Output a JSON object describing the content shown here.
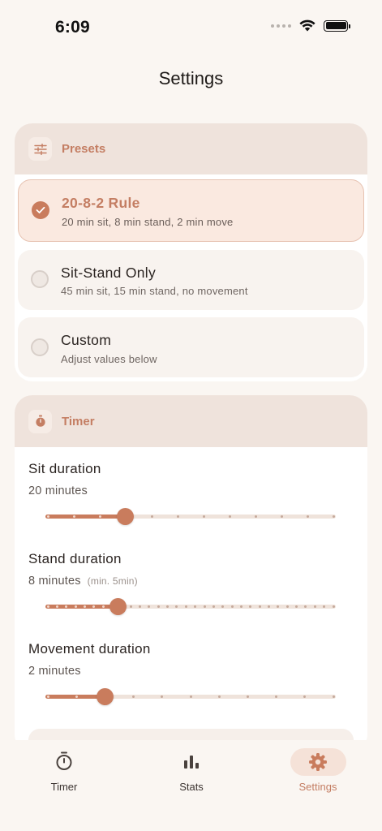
{
  "status_bar": {
    "time": "6:09"
  },
  "page": {
    "title": "Settings"
  },
  "presets_card": {
    "title": "Presets",
    "icon": "sliders-icon",
    "options": [
      {
        "name": "20-8-2 Rule",
        "description": "20 min sit, 8 min stand, 2 min move",
        "selected": true
      },
      {
        "name": "Sit-Stand Only",
        "description": "45 min sit, 15 min stand, no movement",
        "selected": false
      },
      {
        "name": "Custom",
        "description": "Adjust values below",
        "selected": false
      }
    ]
  },
  "timer_card": {
    "title": "Timer",
    "icon": "stopwatch-icon",
    "settings": [
      {
        "label": "Sit duration",
        "value": "20 minutes",
        "hint": "",
        "slider": {
          "level": 0.27,
          "steps": 11
        }
      },
      {
        "label": "Stand duration",
        "value": "8 minutes",
        "hint": "(min. 5min)",
        "slider": {
          "level": 0.245,
          "steps": 31
        }
      },
      {
        "label": "Movement duration",
        "value": "2 minutes",
        "hint": "",
        "slider": {
          "level": 0.2,
          "steps": 10
        }
      }
    ]
  },
  "tab_bar": {
    "tabs": [
      {
        "label": "Timer",
        "icon": "stopwatch-icon",
        "active": false
      },
      {
        "label": "Stats",
        "icon": "bar-chart-icon",
        "active": false
      },
      {
        "label": "Settings",
        "icon": "gear-icon",
        "active": true
      }
    ]
  },
  "colors": {
    "accent": "#c97c5d",
    "header": "#efe3dc",
    "background": "#faf6f2"
  }
}
